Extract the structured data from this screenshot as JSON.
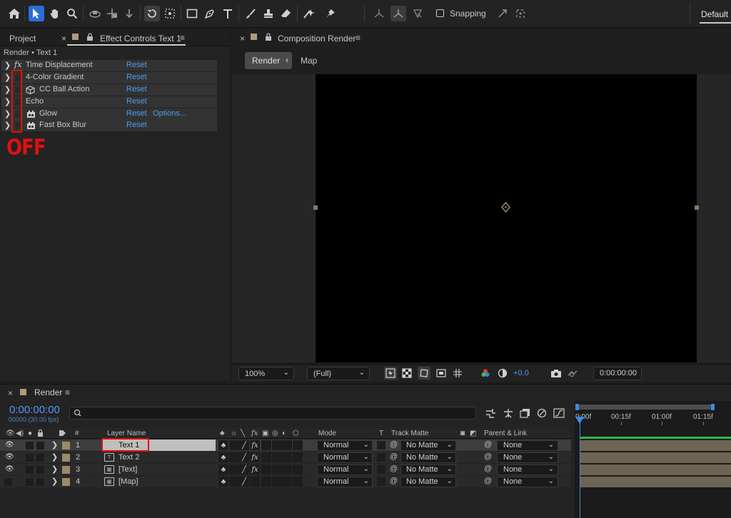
{
  "toolbar": {
    "snapping_label": "Snapping",
    "workspace_label": "Default"
  },
  "left_panel": {
    "tabs": [
      {
        "label": "Project"
      },
      {
        "label": "Effect Controls Text 1"
      }
    ],
    "breadcrumb": "Render • Text 1",
    "effects": [
      {
        "name": "Time Displacement",
        "reset": "Reset",
        "icon": "fx-icon"
      },
      {
        "name": "4-Color Gradient",
        "reset": "Reset",
        "icon": "none"
      },
      {
        "name": "CC Ball Action",
        "reset": "Reset",
        "icon": "cube-3d-icon"
      },
      {
        "name": "Echo",
        "reset": "Reset",
        "icon": "none"
      },
      {
        "name": "Glow",
        "reset": "Reset",
        "options": "Options...",
        "icon": "gpu-icon"
      },
      {
        "name": "Fast Box Blur",
        "reset": "Reset",
        "icon": "gpu-icon"
      }
    ],
    "off_annotation": "OFF"
  },
  "comp_panel": {
    "tab_label": "Composition Render",
    "render_button": "Render",
    "map_label": "Map",
    "footer": {
      "zoom": "100%",
      "resolution": "(Full)",
      "exposure": "+0.0",
      "timecode": "0:00:00:00"
    }
  },
  "timeline": {
    "tab_label": "Render",
    "current_time": "0:00:00:00",
    "fps_label": "00000 (30.00 fps)",
    "columns": {
      "number": "#",
      "layer_name": "Layer Name",
      "mode": "Mode",
      "t": "T",
      "track_matte": "Track Matte",
      "parent_link": "Parent & Link"
    },
    "ruler_ticks": [
      "0:00f",
      "00:15f",
      "01:00f",
      "01:15f"
    ],
    "layers": [
      {
        "index": "1",
        "name": "Text 1",
        "mode": "Normal",
        "matte": "No Matte",
        "parent": "None",
        "fx": true,
        "selected": true
      },
      {
        "index": "2",
        "name": "Text 2",
        "mode": "Normal",
        "matte": "No Matte",
        "parent": "None",
        "fx": true,
        "selected": false
      },
      {
        "index": "3",
        "name": "[Text]",
        "mode": "Normal",
        "matte": "No Matte",
        "parent": "None",
        "fx": true,
        "selected": false
      },
      {
        "index": "4",
        "name": "[Map]",
        "mode": "Normal",
        "matte": "No Matte",
        "parent": "None",
        "fx": false,
        "selected": false
      }
    ]
  },
  "colors": {
    "accent_blue": "#4d9bf0",
    "annotation_red": "#e01010",
    "label_tan": "#b29a78",
    "timeline_green": "#2fb84a"
  }
}
